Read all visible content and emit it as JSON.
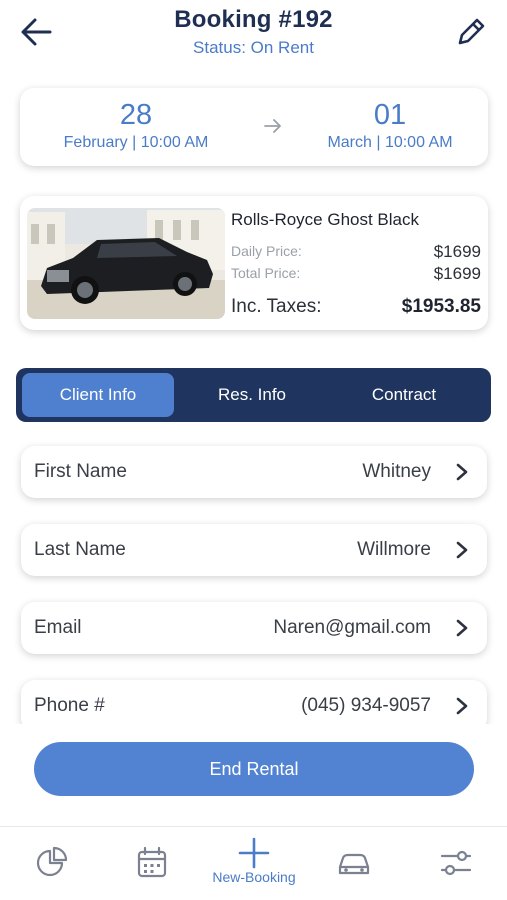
{
  "header": {
    "title": "Booking #192",
    "status": "Status: On Rent"
  },
  "dates": {
    "start_day": "28",
    "start_time": "February | 10:00 AM",
    "end_day": "01",
    "end_time": "March | 10:00 AM"
  },
  "car": {
    "name": "Rolls-Royce Ghost Black",
    "daily_label": "Daily Price:",
    "daily_value": "$1699",
    "total_label": "Total Price:",
    "total_value": "$1699",
    "tax_label": "Inc. Taxes:",
    "tax_value": "$1953.85"
  },
  "tabs": [
    "Client Info",
    "Res. Info",
    "Contract"
  ],
  "fields": [
    {
      "label": "First Name",
      "value": "Whitney"
    },
    {
      "label": "Last Name",
      "value": "Willmore"
    },
    {
      "label": "Email",
      "value": "Naren@gmail.com"
    },
    {
      "label": "Phone #",
      "value": "(045) 934-9057"
    }
  ],
  "actions": {
    "end_rental": "End Rental"
  },
  "bottom_nav": {
    "items": [
      "pie-chart-icon",
      "calendar-icon",
      "plus-icon",
      "car-icon",
      "sliders-icon"
    ],
    "active_label": "New-Booking"
  },
  "colors": {
    "accent": "#4a7cc7",
    "navy": "#1f3560",
    "button": "#5283d2"
  }
}
